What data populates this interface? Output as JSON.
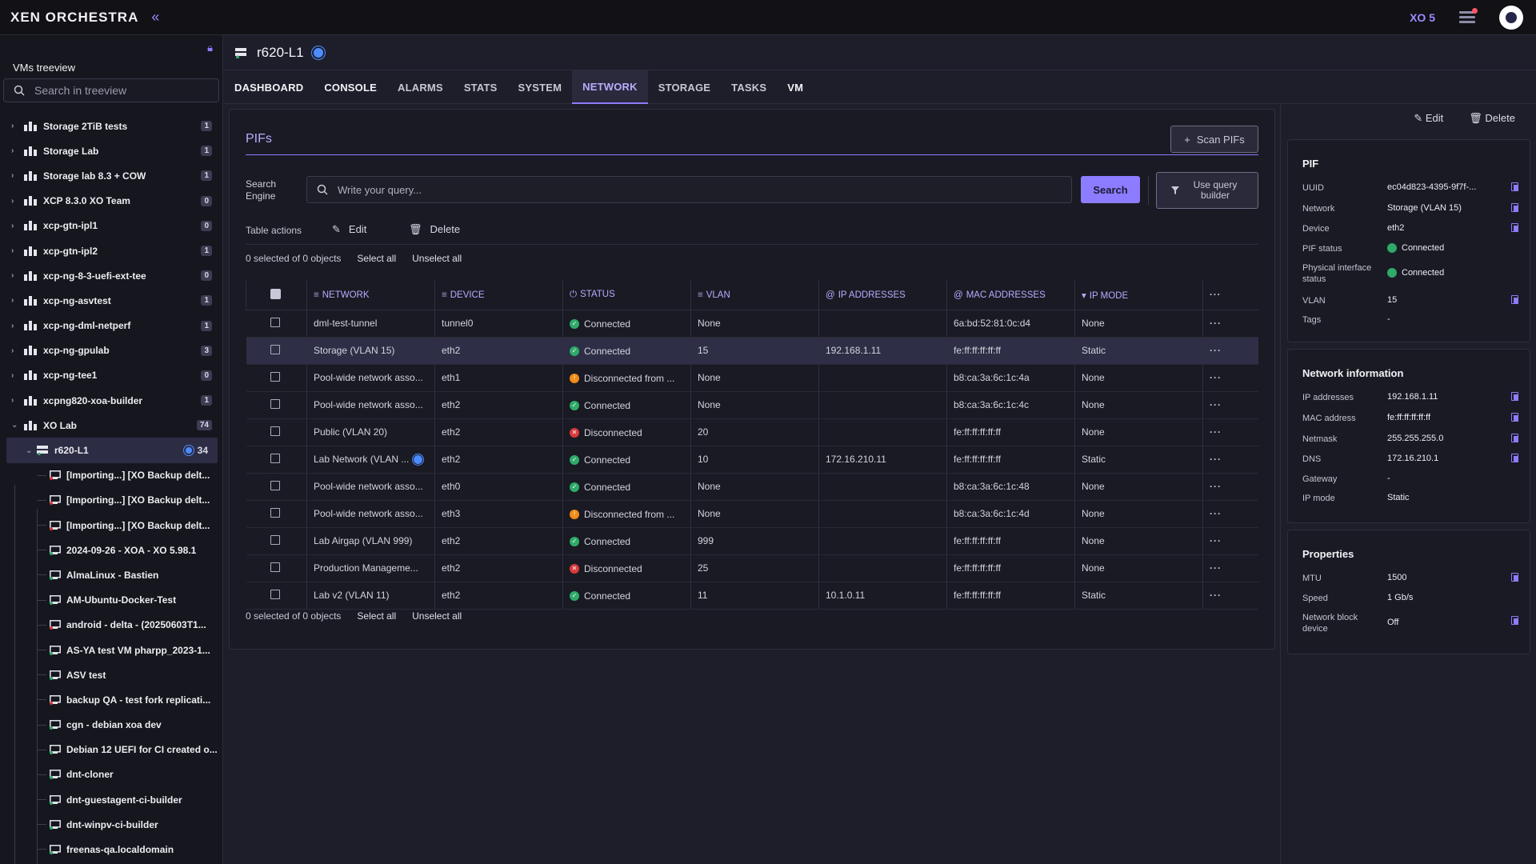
{
  "app": {
    "logo": "XEN ORCHESTRA",
    "version": "XO 5"
  },
  "sidebar": {
    "title": "VMs treeview",
    "search_placeholder": "Search in treeview",
    "pools": [
      {
        "label": "Storage 2TiB tests",
        "count": "1"
      },
      {
        "label": "Storage Lab",
        "count": "1"
      },
      {
        "label": "Storage lab 8.3 + COW",
        "count": "1"
      },
      {
        "label": "XCP 8.3.0 XO Team",
        "count": "0"
      },
      {
        "label": "xcp-gtn-ipl1",
        "count": "0"
      },
      {
        "label": "xcp-gtn-ipl2",
        "count": "1"
      },
      {
        "label": "xcp-ng-8-3-uefi-ext-tee",
        "count": "0"
      },
      {
        "label": "xcp-ng-asvtest",
        "count": "1"
      },
      {
        "label": "xcp-ng-dml-netperf",
        "count": "1"
      },
      {
        "label": "xcp-ng-gpulab",
        "count": "3"
      },
      {
        "label": "xcp-ng-tee1",
        "count": "0"
      },
      {
        "label": "xcpng820-xoa-builder",
        "count": "1"
      },
      {
        "label": "XO Lab",
        "count": "74"
      }
    ],
    "host": {
      "label": "r620-L1",
      "count": "34"
    },
    "vms": [
      "[Importing...] [XO Backup delt...",
      "[Importing...] [XO Backup delt...",
      "[Importing...] [XO Backup delt...",
      "2024-09-26 - XOA - XO 5.98.1",
      "AlmaLinux - Bastien",
      "AM-Ubuntu-Docker-Test",
      "android - delta - (20250603T1...",
      "AS-YA test VM pharpp_2023-1...",
      "ASV test",
      "backup QA - test fork replicati...",
      "cgn - debian xoa dev",
      "Debian 12 UEFI for CI created o...",
      "dnt-cloner",
      "dnt-guestagent-ci-builder",
      "dnt-winpv-ci-builder",
      "freenas-qa.localdomain"
    ]
  },
  "header": {
    "title": "r620-L1"
  },
  "tabs": [
    "DASHBOARD",
    "CONSOLE",
    "ALARMS",
    "STATS",
    "SYSTEM",
    "NETWORK",
    "STORAGE",
    "TASKS",
    "VM"
  ],
  "pifs": {
    "title": "PIFs",
    "scan_label": "Scan PIFs",
    "search_engine_label": "Search Engine",
    "query_placeholder": "Write your query...",
    "search_label": "Search",
    "query_builder_label": "Use query builder",
    "table_actions_label": "Table actions",
    "edit_label": "Edit",
    "delete_label": "Delete",
    "selection_text": "0 selected of 0 objects",
    "select_all": "Select all",
    "unselect_all": "Unselect all",
    "columns": [
      "NETWORK",
      "DEVICE",
      "STATUS",
      "VLAN",
      "IP ADDRESSES",
      "MAC ADDRESSES",
      "IP MODE"
    ],
    "more_label": "···",
    "rows": [
      {
        "network": "dml-test-tunnel",
        "device": "tunnel0",
        "status": "Connected",
        "state": "ok",
        "vlan": "None",
        "ip": "",
        "mac": "6a:bd:52:81:0c:d4",
        "mode": "None"
      },
      {
        "network": "Storage (VLAN 15)",
        "device": "eth2",
        "status": "Connected",
        "state": "ok",
        "vlan": "15",
        "ip": "192.168.1.11",
        "mac": "fe:ff:ff:ff:ff:ff",
        "mode": "Static"
      },
      {
        "network": "Pool-wide network asso...",
        "device": "eth1",
        "status": "Disconnected from ...",
        "state": "warn",
        "vlan": "None",
        "ip": "",
        "mac": "b8:ca:3a:6c:1c:4a",
        "mode": "None"
      },
      {
        "network": "Pool-wide network asso...",
        "device": "eth2",
        "status": "Connected",
        "state": "ok",
        "vlan": "None",
        "ip": "",
        "mac": "b8:ca:3a:6c:1c:4c",
        "mode": "None"
      },
      {
        "network": "Public (VLAN 20)",
        "device": "eth2",
        "status": "Disconnected",
        "state": "err",
        "vlan": "20",
        "ip": "",
        "mac": "fe:ff:ff:ff:ff:ff",
        "mode": "None"
      },
      {
        "network": "Lab Network (VLAN ...",
        "device": "eth2",
        "status": "Connected",
        "state": "ok",
        "vlan": "10",
        "ip": "172.16.210.11",
        "mac": "fe:ff:ff:ff:ff:ff",
        "mode": "Static"
      },
      {
        "network": "Pool-wide network asso...",
        "device": "eth0",
        "status": "Connected",
        "state": "ok",
        "vlan": "None",
        "ip": "",
        "mac": "b8:ca:3a:6c:1c:48",
        "mode": "None"
      },
      {
        "network": "Pool-wide network asso...",
        "device": "eth3",
        "status": "Disconnected from ...",
        "state": "warn",
        "vlan": "None",
        "ip": "",
        "mac": "b8:ca:3a:6c:1c:4d",
        "mode": "None"
      },
      {
        "network": "Lab Airgap (VLAN 999)",
        "device": "eth2",
        "status": "Connected",
        "state": "ok",
        "vlan": "999",
        "ip": "",
        "mac": "fe:ff:ff:ff:ff:ff",
        "mode": "None"
      },
      {
        "network": "Production Manageme...",
        "device": "eth2",
        "status": "Disconnected",
        "state": "err",
        "vlan": "25",
        "ip": "",
        "mac": "fe:ff:ff:ff:ff:ff",
        "mode": "None"
      },
      {
        "network": "Lab v2 (VLAN 11)",
        "device": "eth2",
        "status": "Connected",
        "state": "ok",
        "vlan": "11",
        "ip": "10.1.0.11",
        "mac": "fe:ff:ff:ff:ff:ff",
        "mode": "Static"
      }
    ]
  },
  "panel": {
    "edit_label": "Edit",
    "delete_label": "Delete",
    "pif": {
      "title": "PIF",
      "uuid_k": "UUID",
      "uuid_v": "ec04d823-4395-9f7f-...",
      "network_k": "Network",
      "network_v": "Storage (VLAN 15)",
      "device_k": "Device",
      "device_v": "eth2",
      "status_k": "PIF status",
      "status_v": "Connected",
      "phys_k": "Physical interface status",
      "phys_v": "Connected",
      "vlan_k": "VLAN",
      "vlan_v": "15",
      "tags_k": "Tags",
      "tags_v": "-"
    },
    "netinfo": {
      "title": "Network information",
      "ip_k": "IP addresses",
      "ip_v": "192.168.1.11",
      "mac_k": "MAC address",
      "mac_v": "fe:ff:ff:ff:ff:ff",
      "mask_k": "Netmask",
      "mask_v": "255.255.255.0",
      "dns_k": "DNS",
      "dns_v": "172.16.210.1",
      "gw_k": "Gateway",
      "gw_v": "-",
      "mode_k": "IP mode",
      "mode_v": "Static"
    },
    "props": {
      "title": "Properties",
      "mtu_k": "MTU",
      "mtu_v": "1500",
      "speed_k": "Speed",
      "speed_v": "1 Gb/s",
      "nbd_k": "Network block device",
      "nbd_v": "Off"
    }
  },
  "colors": {
    "accent": "#8c7cff",
    "ok": "#2faa6a",
    "warn": "#f08c1a",
    "err": "#d93a3a",
    "badge": "#4c8cff"
  }
}
